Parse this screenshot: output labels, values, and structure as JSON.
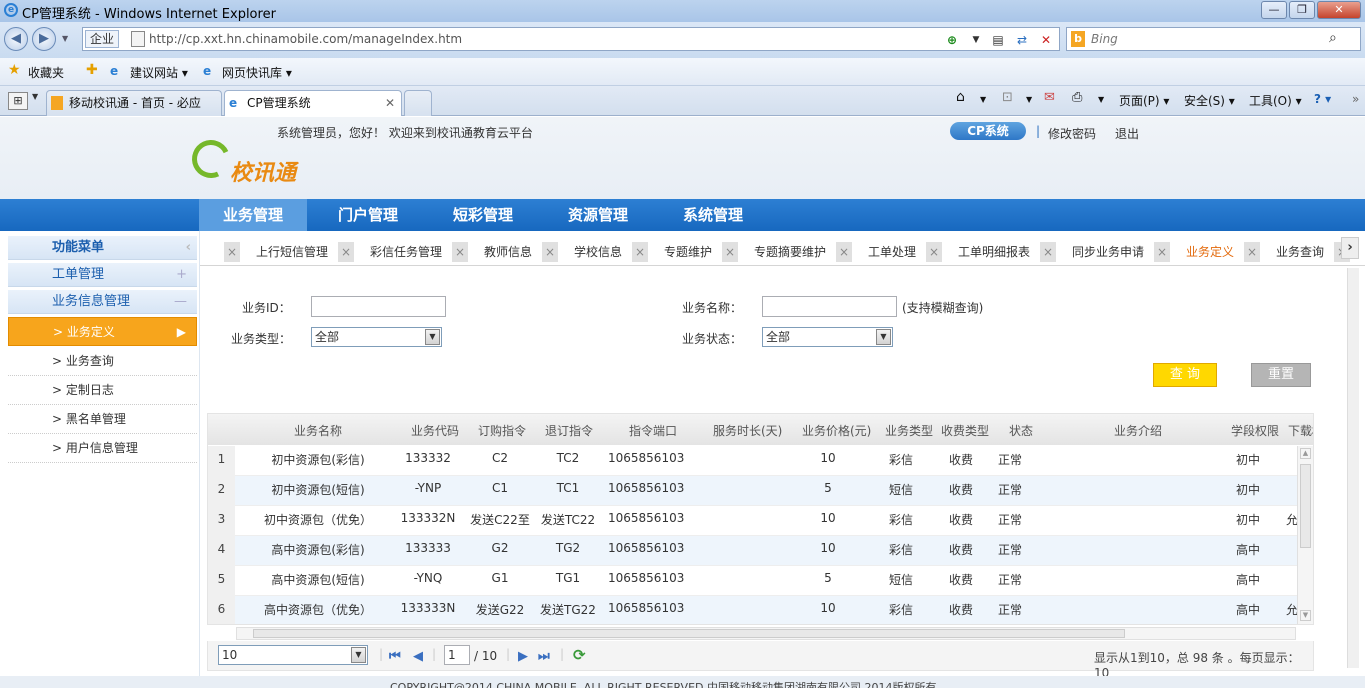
{
  "window": {
    "title": "CP管理系统 - Windows Internet Explorer",
    "min": "—",
    "max": "❐",
    "close": "✕"
  },
  "address": {
    "zone": "企业",
    "url": "http://cp.xxt.hn.chinamobile.com/manageIndex.htm",
    "search_placeholder": "Bing"
  },
  "favorites": {
    "label": "收藏夹",
    "items": [
      "建议网站 ▾",
      "网页快讯库 ▾"
    ]
  },
  "browser_tabs": [
    {
      "title": "移动校讯通 - 首页 - 必应"
    },
    {
      "title": "CP管理系统"
    }
  ],
  "commands": {
    "page": "页面(P) ▾",
    "safety": "安全(S) ▾",
    "tools": "工具(O) ▾",
    "help": "? ▾"
  },
  "header": {
    "logo_text": "校讯通",
    "welcome": "系统管理员，您好！ 欢迎来到校讯通教育云平台",
    "cp_system": "CP系统",
    "change_password": "修改密码",
    "logout": "退出"
  },
  "main_nav": [
    "业务管理",
    "门户管理",
    "短彩管理",
    "资源管理",
    "系统管理"
  ],
  "sidebar": {
    "title": "功能菜单",
    "groups": [
      {
        "label": "工单管理"
      },
      {
        "label": "业务信息管理"
      }
    ],
    "items": [
      "> 业务定义",
      "> 业务查询",
      "> 定制日志",
      "> 黑名单管理",
      "> 用户信息管理"
    ]
  },
  "tabs": [
    "上行短信管理",
    "彩信任务管理",
    "教师信息",
    "学校信息",
    "专题维护",
    "专题摘要维护",
    "工单处理",
    "工单明细报表",
    "同步业务申请",
    "业务定义",
    "业务查询"
  ],
  "filter": {
    "service_id_label": "业务ID：",
    "service_name_label": "业务名称：",
    "fuzzy_hint": "(支持模糊查询)",
    "service_type_label": "业务类型：",
    "service_type_value": "全部",
    "service_status_label": "业务状态：",
    "service_status_value": "全部",
    "query_button": "查 询",
    "reset_button": "重置"
  },
  "grid": {
    "headers": [
      "业务名称",
      "业务代码",
      "订购指令",
      "退订指令",
      "指令端口",
      "服务时长(天)",
      "业务价格(元)",
      "业务类型",
      "收费类型",
      "状态",
      "业务介绍",
      "学段权限",
      "下载权"
    ],
    "rows": [
      {
        "n": "1",
        "name": "初中资源包(彩信)",
        "code": "133332",
        "sub": "C2",
        "unsub": "TC2",
        "port": "1065856103",
        "days": "",
        "price": "10",
        "type": "彩信",
        "charge": "收费",
        "status": "正常",
        "intro": "",
        "level": "初中",
        "dl": ""
      },
      {
        "n": "2",
        "name": "初中资源包(短信)",
        "code": "-YNP",
        "sub": "C1",
        "unsub": "TC1",
        "port": "1065856103",
        "days": "",
        "price": "5",
        "type": "短信",
        "charge": "收费",
        "status": "正常",
        "intro": "",
        "level": "初中",
        "dl": ""
      },
      {
        "n": "3",
        "name": "初中资源包（优免）",
        "code": "133332N",
        "sub": "发送C22至",
        "unsub": "发送TC22",
        "port": "1065856103",
        "days": "",
        "price": "10",
        "type": "彩信",
        "charge": "收费",
        "status": "正常",
        "intro": "",
        "level": "初中",
        "dl": "允"
      },
      {
        "n": "4",
        "name": "高中资源包(彩信)",
        "code": "133333",
        "sub": "G2",
        "unsub": "TG2",
        "port": "1065856103",
        "days": "",
        "price": "10",
        "type": "彩信",
        "charge": "收费",
        "status": "正常",
        "intro": "",
        "level": "高中",
        "dl": ""
      },
      {
        "n": "5",
        "name": "高中资源包(短信)",
        "code": "-YNQ",
        "sub": "G1",
        "unsub": "TG1",
        "port": "1065856103",
        "days": "",
        "price": "5",
        "type": "短信",
        "charge": "收费",
        "status": "正常",
        "intro": "",
        "level": "高中",
        "dl": ""
      },
      {
        "n": "6",
        "name": "高中资源包（优免）",
        "code": "133333N",
        "sub": "发送G22",
        "unsub": "发送TG22",
        "port": "1065856103",
        "days": "",
        "price": "10",
        "type": "彩信",
        "charge": "收费",
        "status": "正常",
        "intro": "",
        "level": "高中",
        "dl": "允"
      }
    ]
  },
  "pager": {
    "page_size": "10",
    "current_page": "1",
    "total_pages": "/ 10",
    "summary": "显示从1到10，总 98 条 。每页显示：10"
  },
  "footer": "COPYRIGHT@2014 CHINA MOBILE. ALL RIGHT RESERVED 中国移动移动集团湖南有限公司 2014版权所有"
}
